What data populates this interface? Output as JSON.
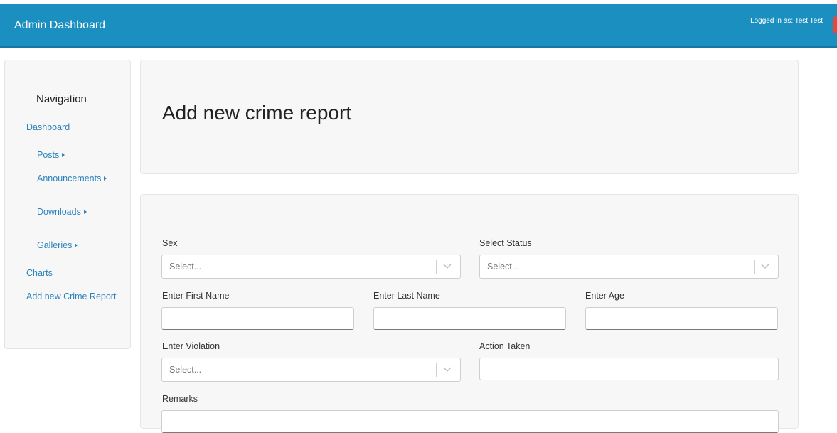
{
  "header": {
    "brand": "Admin Dashboard",
    "logged_in": "Logged in as: Test Test"
  },
  "sidebar": {
    "title": "Navigation",
    "items": [
      {
        "label": "Dashboard"
      },
      {
        "label": "Posts"
      },
      {
        "label": "Announcements"
      },
      {
        "label": "Downloads"
      },
      {
        "label": "Galleries"
      },
      {
        "label": "Charts"
      },
      {
        "label": "Add new Crime Report"
      }
    ]
  },
  "page": {
    "title": "Add new crime report"
  },
  "form": {
    "sex": {
      "label": "Sex",
      "placeholder": "Select..."
    },
    "status": {
      "label": "Select Status",
      "placeholder": "Select..."
    },
    "first_name": {
      "label": "Enter First Name",
      "value": ""
    },
    "last_name": {
      "label": "Enter Last Name",
      "value": ""
    },
    "age": {
      "label": "Enter Age",
      "value": ""
    },
    "violation": {
      "label": "Enter Violation",
      "placeholder": "Select..."
    },
    "action": {
      "label": "Action Taken",
      "value": ""
    },
    "remarks": {
      "label": "Remarks",
      "value": ""
    }
  },
  "colors": {
    "header_bg": "#1a8fc0",
    "link": "#2b82bd",
    "logout_accent": "#e4473c"
  }
}
